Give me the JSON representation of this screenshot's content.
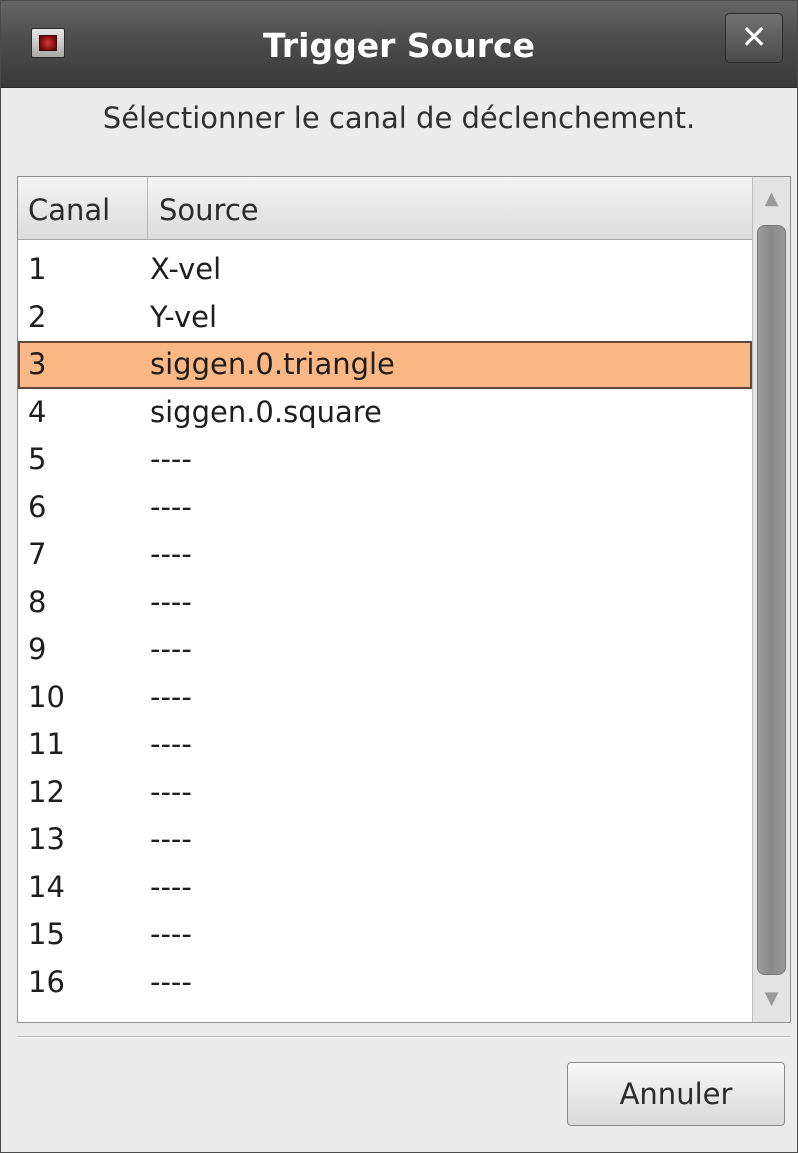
{
  "window": {
    "title": "Trigger Source",
    "close_glyph": "✕"
  },
  "prompt": "Sélectionner le canal de déclenchement.",
  "table": {
    "columns": [
      "Canal",
      "Source"
    ],
    "selected_index": 2,
    "selection_color": "#fbb784",
    "rows": [
      {
        "canal": "1",
        "source": "X-vel"
      },
      {
        "canal": "2",
        "source": "Y-vel"
      },
      {
        "canal": "3",
        "source": "siggen.0.triangle"
      },
      {
        "canal": "4",
        "source": "siggen.0.square"
      },
      {
        "canal": "5",
        "source": "----"
      },
      {
        "canal": "6",
        "source": "----"
      },
      {
        "canal": "7",
        "source": "----"
      },
      {
        "canal": "8",
        "source": "----"
      },
      {
        "canal": "9",
        "source": "----"
      },
      {
        "canal": "10",
        "source": "----"
      },
      {
        "canal": "11",
        "source": "----"
      },
      {
        "canal": "12",
        "source": "----"
      },
      {
        "canal": "13",
        "source": "----"
      },
      {
        "canal": "14",
        "source": "----"
      },
      {
        "canal": "15",
        "source": "----"
      },
      {
        "canal": "16",
        "source": "----"
      }
    ]
  },
  "scrollbar": {
    "up_glyph": "▲",
    "down_glyph": "▼"
  },
  "buttons": {
    "cancel_label": "Annuler"
  },
  "icons": {
    "app": "app-icon",
    "close": "close-icon"
  }
}
